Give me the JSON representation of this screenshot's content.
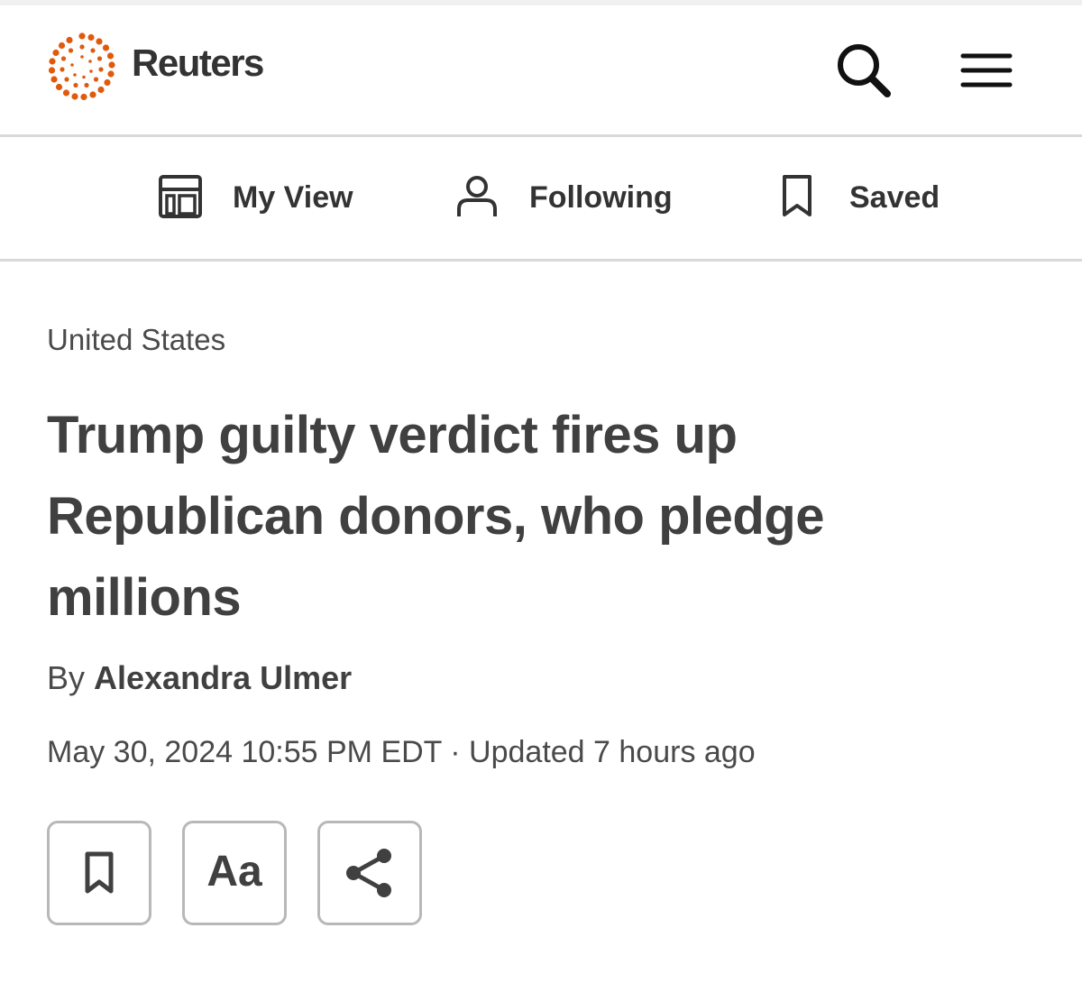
{
  "header": {
    "brand": "Reuters",
    "logo_color": "#e05a0c",
    "icons": [
      "search-icon",
      "hamburger-menu-icon"
    ]
  },
  "subnav": {
    "items": [
      {
        "label": "My View",
        "icon": "layout-icon"
      },
      {
        "label": "Following",
        "icon": "person-icon"
      },
      {
        "label": "Saved",
        "icon": "bookmark-icon"
      }
    ]
  },
  "article": {
    "category": "United States",
    "headline": "Trump guilty verdict fires up Republican donors, who pledge millions",
    "byline_prefix": "By ",
    "author": "Alexandra Ulmer",
    "dateline": "May 30, 2024 10:55 PM EDT · Updated 7 hours ago"
  },
  "actions": {
    "font_size_label": "Aa",
    "icons": [
      "bookmark-icon",
      "font-size-icon",
      "share-icon"
    ]
  }
}
